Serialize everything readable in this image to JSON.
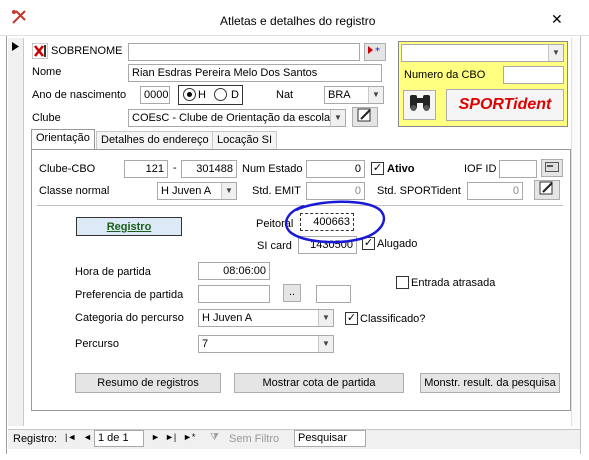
{
  "window": {
    "title": "Atletas e detalhes do registro",
    "close_glyph": "✕"
  },
  "header": {
    "sobrenome_label": "SOBRENOME",
    "sobrenome_value": "",
    "nome_label": "Nome",
    "nome_value": "Rian Esdras Pereira Melo Dos Santos",
    "ano_label": "Ano de nascimento",
    "ano_value": "0000",
    "sex_h": "H",
    "sex_d": "D",
    "nat_label": "Nat",
    "nat_value": "BRA",
    "clube_label": "Clube",
    "clube_value": "COEsC - Clube de Orientação da escola de",
    "cbo_label": "Numero da CBO",
    "cbo_value": "",
    "top_combo_value": "",
    "sportident_label": "SPORTident"
  },
  "tabs": [
    {
      "label": "Orientação"
    },
    {
      "label": "Detalhes do endereço"
    },
    {
      "label": "Locação SI"
    }
  ],
  "orient": {
    "clube_cbo_label": "Clube-CBO",
    "clube_cbo_a": "121",
    "dash": "-",
    "clube_cbo_b": "301488",
    "num_estado_label": "Num Estado",
    "num_estado_value": "0",
    "ativo_label": "Ativo",
    "iof_label": "IOF ID",
    "iof_value": "",
    "classe_label": "Classe normal",
    "classe_value": "H Juven A",
    "std_emit_label": "Std. EMIT",
    "std_emit_value": "0",
    "std_sport_label": "Std. SPORTident",
    "std_sport_value": "0",
    "registro_btn": "Registro",
    "peitoral_label": "Peitoral",
    "peitoral_value": "400663",
    "sicard_label": "SI card",
    "sicard_value": "1430500",
    "alugado_label": "Alugado",
    "hora_label": "Hora de partida",
    "hora_value": "08:06:00",
    "entrada_label": "Entrada atrasada",
    "pref_label": "Preferencia de partida",
    "pref_btn": "..",
    "categoria_label": "Categoria do percurso",
    "categoria_value": "H Juven A",
    "classificado_label": "Classificado?",
    "percurso_label": "Percurso",
    "percurso_value": "7",
    "btn_resumo": "Resumo de registros",
    "btn_cota": "Mostrar cota de partida",
    "btn_result": "Monstr. result. da pesquisa"
  },
  "recordnav": {
    "label": "Registro:",
    "position": "1 de 1",
    "filter": "Sem Filtro",
    "search": "Pesquisar"
  },
  "colors": {
    "highlight": "#ffff80",
    "annotation": "#1a1ad6",
    "sportident_red": "#e00000",
    "registro_bg": "#dceaf7"
  }
}
